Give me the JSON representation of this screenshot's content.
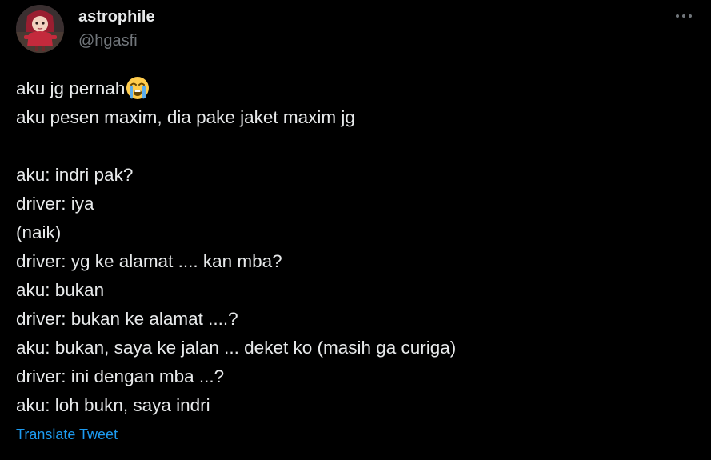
{
  "author": {
    "display_name": "astrophile",
    "handle": "@hgasfi",
    "avatar_icon": "profile-avatar-icon"
  },
  "more_icon": "more-horizontal-icon",
  "tweet": {
    "lines": [
      "aku jg pernah",
      "aku pesen maxim, dia pake jaket maxim jg",
      "",
      "aku: indri pak?",
      "driver: iya",
      "(naik)",
      "driver: yg ke alamat .... kan mba?",
      "aku: bukan",
      "driver: bukan ke alamat ....?",
      "aku: bukan, saya ke jalan ... deket ko (masih ga curiga)",
      "driver: ini dengan mba ...?",
      "aku: loh bukn, saya indri"
    ],
    "emoji_icon": "loudly-crying-face-icon"
  },
  "translate_label": "Translate Tweet",
  "colors": {
    "background": "#000000",
    "text": "#e7e9ea",
    "secondary_text": "#71767b",
    "link": "#1d9bf0"
  }
}
